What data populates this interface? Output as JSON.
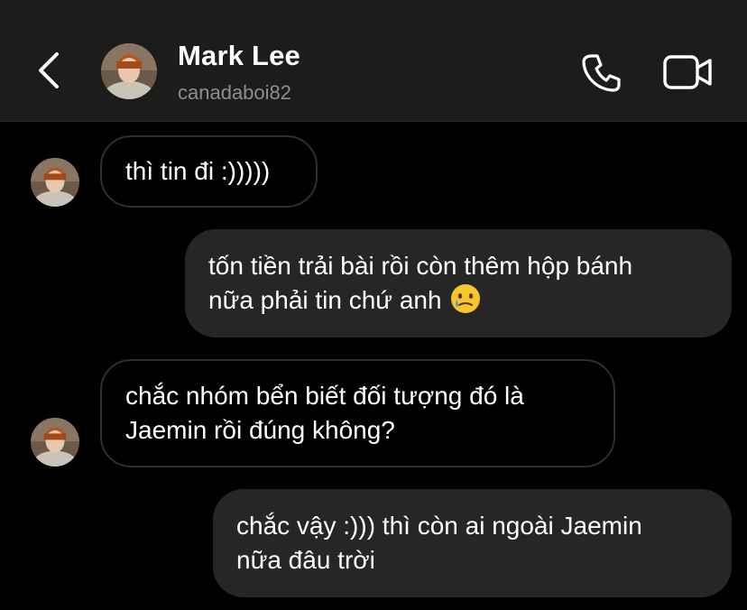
{
  "header": {
    "name": "Mark Lee",
    "username": "canadaboi82"
  },
  "messages": [
    {
      "direction": "incoming",
      "text": "thì tin đi :)))))"
    },
    {
      "direction": "outgoing",
      "text": "tốn tiền trải bài rồi còn thêm hộp bánh\nnữa phải tin chứ anh",
      "emoji": "face-holding-back-tears"
    },
    {
      "direction": "incoming",
      "text": "chắc nhóm bển biết đối tượng đó là\nJaemin rồi đúng không?"
    },
    {
      "direction": "outgoing",
      "text": "chắc vậy :))) thì còn ai ngoài Jaemin\nnữa đâu trời"
    }
  ],
  "colors": {
    "background": "#000000",
    "header_background": "#1c1c1c",
    "outgoing_bubble": "#262626",
    "incoming_border": "#2f2f2f",
    "text": "#ffffff",
    "secondary_text": "#8e8e8e"
  }
}
